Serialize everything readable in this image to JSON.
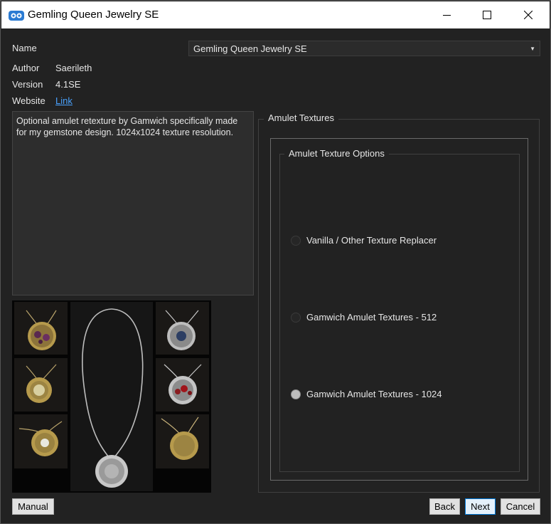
{
  "window": {
    "title": "Gemling Queen Jewelry SE"
  },
  "titlebar_icons": [
    "app-icon",
    "minimize-icon",
    "maximize-icon",
    "close-icon"
  ],
  "fields": {
    "name_label": "Name",
    "name_value": "Gemling Queen Jewelry SE",
    "author_label": "Author",
    "author_value": "Saerileth",
    "version_label": "Version",
    "version_value": "4.1SE",
    "website_label": "Website",
    "website_link": "Link"
  },
  "description": "Optional amulet retexture by Gamwich specifically made for my gemstone design. 1024x1024 texture resolution.",
  "options": {
    "group_title": "Amulet Textures",
    "subgroup_title": "Amulet Texture Options",
    "items": [
      {
        "label": "Vanilla / Other Texture Replacer",
        "checked": false
      },
      {
        "label": "Gamwich Amulet Textures - 512",
        "checked": false
      },
      {
        "label": "Gamwich Amulet Textures - 1024",
        "checked": true
      }
    ]
  },
  "buttons": {
    "manual": "Manual",
    "back": "Back",
    "next": "Next",
    "cancel": "Cancel"
  },
  "colors": {
    "background": "#222222",
    "link": "#4aa3ff",
    "default_button_border": "#0078d7"
  }
}
